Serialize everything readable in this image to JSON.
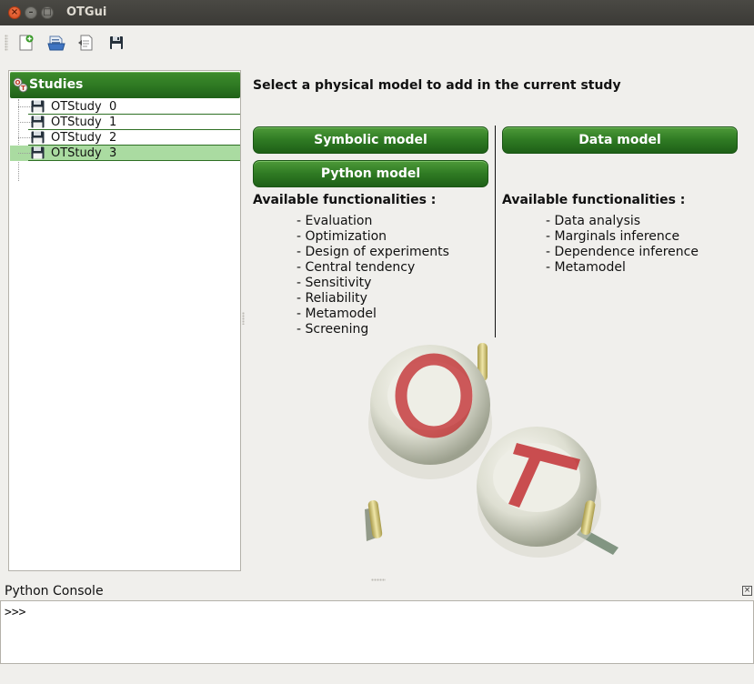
{
  "window": {
    "title": "OTGui",
    "close_glyph": "×",
    "minimize_glyph": "–",
    "maximize_glyph": "□"
  },
  "toolbar": {
    "buttons": [
      {
        "icon": "new-study-icon"
      },
      {
        "icon": "open-study-icon"
      },
      {
        "icon": "import-script-icon"
      },
      {
        "icon": "save-study-icon"
      }
    ]
  },
  "studies_tree": {
    "header": "Studies",
    "items": [
      {
        "label": "OTStudy  0",
        "selected": false
      },
      {
        "label": "OTStudy  1",
        "selected": false
      },
      {
        "label": "OTStudy  2",
        "selected": false
      },
      {
        "label": "OTStudy  3",
        "selected": true
      }
    ]
  },
  "main": {
    "heading": "Select a physical model to add in the current study",
    "buttons": {
      "symbolic": "Symbolic model",
      "python": "Python model",
      "data": "Data model"
    },
    "left_functionalities": {
      "title": "Available functionalities :",
      "items": [
        "- Evaluation",
        "- Optimization",
        "- Design of experiments",
        "- Central tendency",
        "- Sensitivity",
        "- Reliability",
        "- Metamodel",
        "- Screening"
      ]
    },
    "right_functionalities": {
      "title": "Available functionalities :",
      "items": [
        "- Data analysis",
        "- Marginals inference",
        "- Dependence inference",
        "- Metamodel"
      ]
    },
    "logo": {
      "letters": [
        "O",
        "T"
      ]
    }
  },
  "console": {
    "title": "Python Console",
    "prompt": ">>>",
    "close_glyph": "×"
  },
  "colors": {
    "accent_green": "#2f7a23",
    "selection_green": "#aadba1",
    "titlebar": "#3b3a36"
  }
}
